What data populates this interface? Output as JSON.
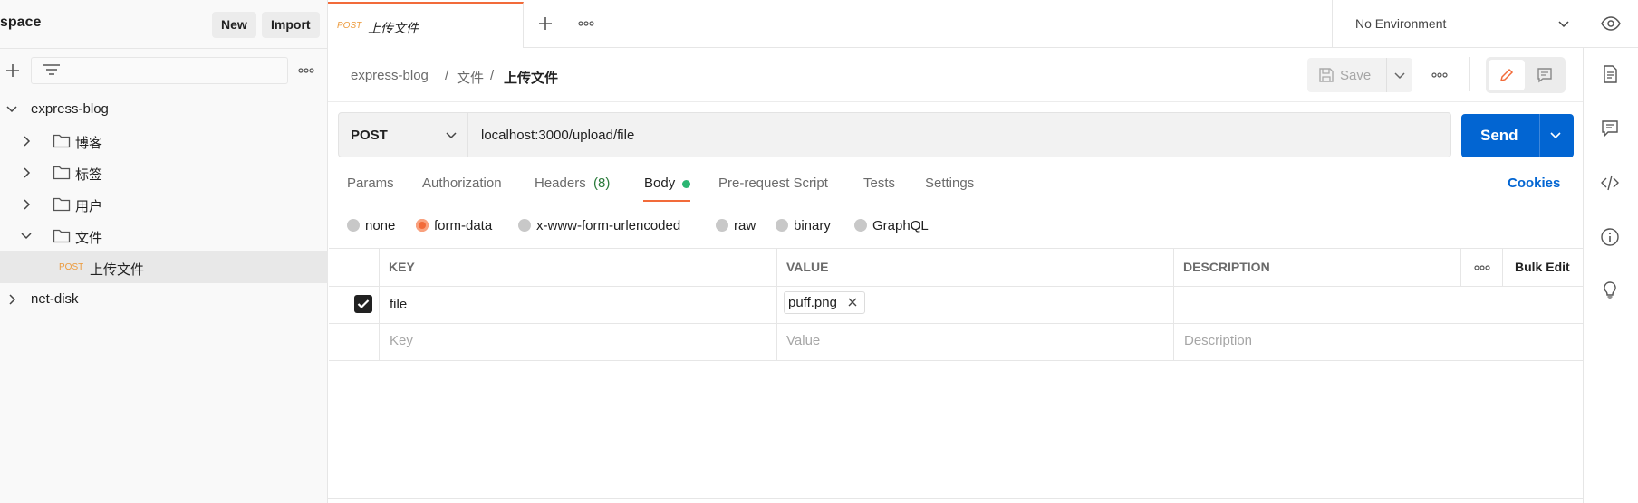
{
  "workspace": {
    "title": "space",
    "new_label": "New",
    "import_label": "Import"
  },
  "tree": {
    "collections": [
      {
        "label": "express-blog",
        "expanded": true
      },
      {
        "label": "net-disk",
        "expanded": false
      }
    ],
    "folders": [
      {
        "label": "博客",
        "expanded": false
      },
      {
        "label": "标签",
        "expanded": false
      },
      {
        "label": "用户",
        "expanded": false
      },
      {
        "label": "文件",
        "expanded": true
      }
    ],
    "request": {
      "method": "POST",
      "label": "上传文件"
    }
  },
  "tab": {
    "method": "POST",
    "title": "上传文件"
  },
  "environment": {
    "selected": "No Environment"
  },
  "breadcrumb": {
    "collection": "express-blog",
    "separator": "/",
    "folder": "文件",
    "request": "上传文件"
  },
  "toolbar": {
    "save_label": "Save"
  },
  "request": {
    "method": "POST",
    "url": "localhost:3000/upload/file",
    "send_label": "Send"
  },
  "request_tabs": {
    "params": "Params",
    "authorization": "Authorization",
    "headers": "Headers",
    "headers_count": "(8)",
    "body": "Body",
    "pre_request": "Pre-request Script",
    "tests": "Tests",
    "settings": "Settings",
    "cookies": "Cookies"
  },
  "body_types": {
    "none": "none",
    "form_data": "form-data",
    "urlencoded": "x-www-form-urlencoded",
    "raw": "raw",
    "binary": "binary",
    "graphql": "GraphQL",
    "selected": "form-data"
  },
  "table": {
    "headers": {
      "key": "KEY",
      "value": "VALUE",
      "description": "DESCRIPTION",
      "bulk_edit": "Bulk Edit"
    },
    "rows": [
      {
        "checked": true,
        "key": "file",
        "value_file": "puff.png",
        "description": ""
      }
    ],
    "placeholders": {
      "key": "Key",
      "value": "Value",
      "description": "Description"
    }
  },
  "colors": {
    "accent": "#f26b3a",
    "primary": "#0265d2",
    "method_post": "#ec9a3c",
    "status_dot": "#2bb673",
    "headers_count": "#2a7a3a"
  },
  "icons": [
    "plus-icon",
    "filter-icon",
    "more-icon",
    "chevron-down-icon",
    "chevron-right-icon",
    "folder-icon",
    "eye-icon",
    "save-icon",
    "pencil-icon",
    "comment-icon",
    "document-icon",
    "code-icon",
    "info-icon",
    "lightbulb-icon",
    "close-icon",
    "checkbox-icon"
  ]
}
